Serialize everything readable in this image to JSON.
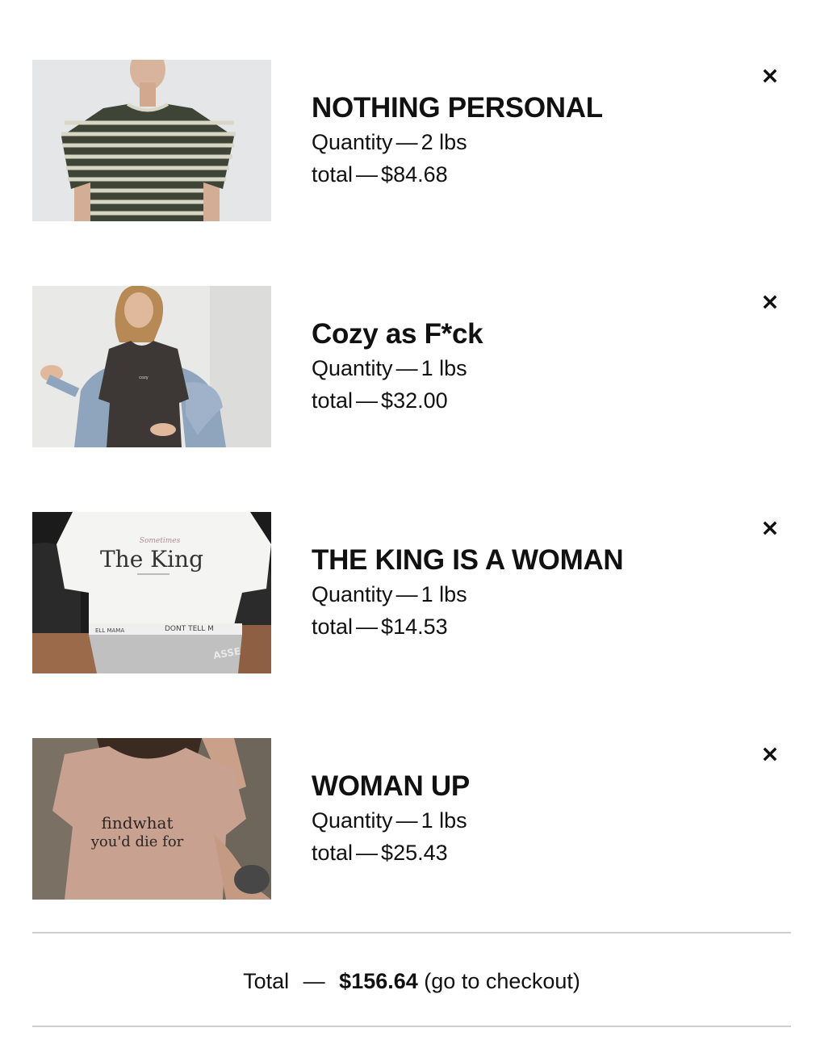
{
  "cart": {
    "items": [
      {
        "name": "NOTHING PERSONAL",
        "quantity_label": "Quantity",
        "quantity_value": "2 lbs",
        "total_label": "total",
        "total_value": "$84.68",
        "image": "striped-tshirt-photo",
        "remove_icon": "close-icon"
      },
      {
        "name": "Cozy as F*ck",
        "quantity_label": "Quantity",
        "quantity_value": "1 lbs",
        "total_label": "total",
        "total_value": "$32.00",
        "image": "black-tshirt-denim-jacket-photo",
        "remove_icon": "close-icon"
      },
      {
        "name": "THE KING IS A WOMAN",
        "quantity_label": "Quantity",
        "quantity_value": "1 lbs",
        "total_label": "total",
        "total_value": "$14.53",
        "image": "white-graphic-tshirt-photo",
        "remove_icon": "close-icon"
      },
      {
        "name": "WOMAN UP",
        "quantity_label": "Quantity",
        "quantity_value": "1 lbs",
        "total_label": "total",
        "total_value": "$25.43",
        "image": "pink-graphic-tshirt-photo",
        "remove_icon": "close-icon"
      }
    ],
    "separator": "—",
    "summary": {
      "label": "Total",
      "amount": "$156.64",
      "checkout_link": "(go to checkout)"
    },
    "image_lettering": {
      "king_script": "Sometimes",
      "king_title": "The King",
      "king_band_left": "ELL MAMA",
      "king_band_right": "DONT TELL M",
      "woman_up_line1": "findwhat",
      "woman_up_line2": "you'd die for"
    },
    "colors": {
      "text": "#111111",
      "divider": "#cfcfcf",
      "background": "#ffffff"
    }
  }
}
